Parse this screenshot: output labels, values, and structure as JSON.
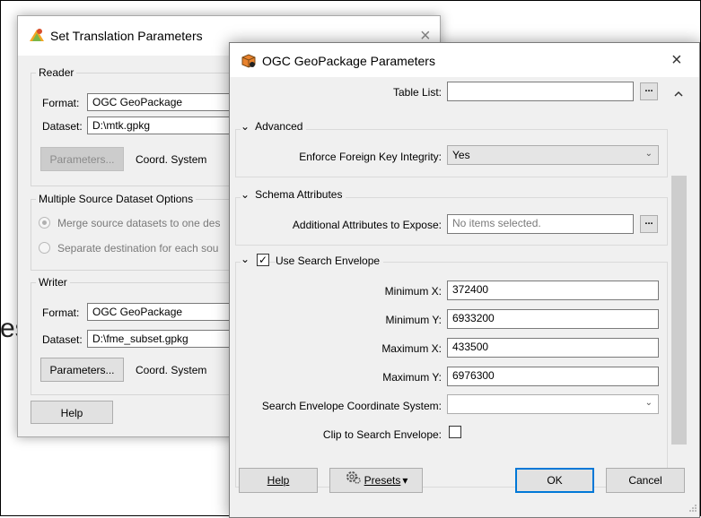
{
  "background_text": "es",
  "back_dialog": {
    "title": "Set Translation Parameters",
    "close_glyph": "×",
    "reader": {
      "group_label": "Reader",
      "format_label": "Format:",
      "format_value": "OGC GeoPackage",
      "dataset_label": "Dataset:",
      "dataset_value": "D:\\mtk.gpkg",
      "parameters_label": "Parameters...",
      "coord_label": "Coord. System"
    },
    "multiple": {
      "group_label": "Multiple Source Dataset Options",
      "merge_label": "Merge source datasets to one des",
      "separate_label": "Separate destination for each sou"
    },
    "writer": {
      "group_label": "Writer",
      "format_label": "Format:",
      "format_value": "OGC GeoPackage",
      "dataset_label": "Dataset:",
      "dataset_value": "D:\\fme_subset.gpkg",
      "parameters_label": "Parameters...",
      "coord_label": "Coord. System"
    },
    "help_label": "Help"
  },
  "front_dialog": {
    "title": "OGC GeoPackage Parameters",
    "close_glyph": "×",
    "table_list_label": "Table List:",
    "table_list_value": "",
    "advanced": {
      "title": "Advanced",
      "enforce_label": "Enforce Foreign Key Integrity:",
      "enforce_value": "Yes"
    },
    "schema": {
      "title": "Schema Attributes",
      "additional_label": "Additional Attributes to Expose:",
      "additional_placeholder": "No items selected."
    },
    "envelope": {
      "title": "Use Search Envelope",
      "checked": true,
      "min_x_label": "Minimum X:",
      "min_x_value": "372400",
      "min_y_label": "Minimum Y:",
      "min_y_value": "6933200",
      "max_x_label": "Maximum X:",
      "max_x_value": "433500",
      "max_y_label": "Maximum Y:",
      "max_y_value": "6976300",
      "coord_label": "Search Envelope Coordinate System:",
      "coord_value": "",
      "clip_label": "Clip to Search Envelope:",
      "clip_checked": false
    },
    "dots_label": "...",
    "check_glyph": "✓",
    "chevron_down": "⌄",
    "footer": {
      "help_label": "Help",
      "presets_label": "Presets",
      "presets_arrow": "▾",
      "ok_label": "OK",
      "cancel_label": "Cancel"
    },
    "colors": {
      "primary_border": "#0078d7",
      "dialog_bg": "#f0f0f0"
    }
  }
}
